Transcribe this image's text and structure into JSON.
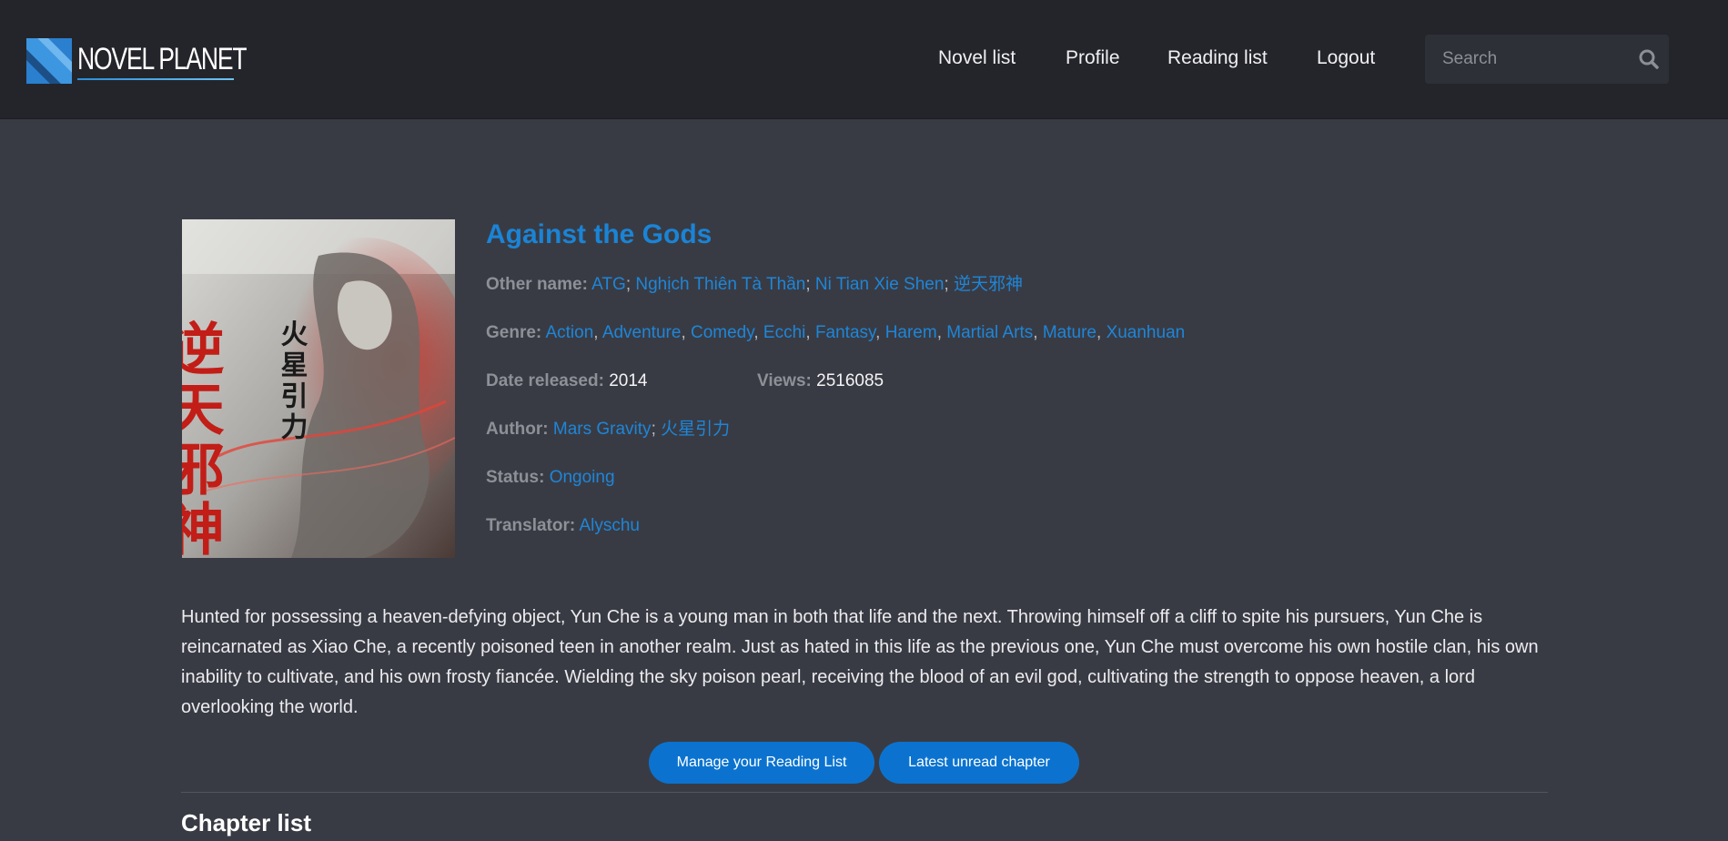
{
  "brand": {
    "name": "NOVEL PLANET"
  },
  "nav": {
    "items": [
      {
        "label": "Novel list"
      },
      {
        "label": "Profile"
      },
      {
        "label": "Reading list"
      },
      {
        "label": "Logout"
      }
    ]
  },
  "search": {
    "placeholder": "Search",
    "icon": "search-icon"
  },
  "novel": {
    "title": "Against the Gods",
    "other_name_label": "Other name:",
    "other_names": [
      "ATG",
      "Nghịch Thiên Tà Thần",
      "Ni Tian Xie Shen",
      "逆天邪神"
    ],
    "genre_label": "Genre:",
    "genres": [
      "Action",
      "Adventure",
      "Comedy",
      "Ecchi",
      "Fantasy",
      "Harem",
      "Martial Arts",
      "Mature",
      "Xuanhuan"
    ],
    "date_label": "Date released:",
    "date": "2014",
    "views_label": "Views:",
    "views": "2516085",
    "author_label": "Author:",
    "authors": [
      "Mars Gravity",
      "火星引力"
    ],
    "status_label": "Status:",
    "status": "Ongoing",
    "translator_label": "Translator:",
    "translator": "Alyschu",
    "cover_text": [
      "逆天邪神",
      "火星引力"
    ],
    "description": "Hunted for possessing a heaven-defying object, Yun Che is a young man in both that life and the next. Throwing himself off a cliff to spite his pursuers, Yun Che is reincarnated as Xiao Che, a recently poisoned teen in another realm. Just as hated in this life as the previous one, Yun Che must overcome his own hostile clan, his own inability to cultivate, and his own frosty fiancée. Wielding the sky poison pearl, receiving the blood of an evil god, cultivating the strength to oppose heaven, a lord overlooking the world."
  },
  "actions": {
    "manage_label": "Manage your Reading List",
    "latest_label": "Latest unread chapter"
  },
  "chapters": {
    "heading": "Chapter list"
  },
  "colors": {
    "page_bg": "#393b44",
    "header_bg": "#24252b",
    "link": "#1e86d8",
    "button": "#0b73cf"
  }
}
